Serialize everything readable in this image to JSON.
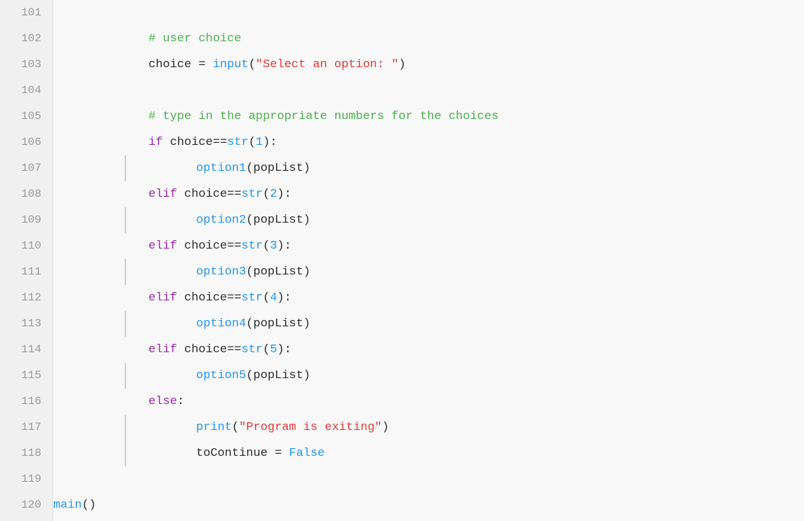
{
  "editor": {
    "background": "#f8f8f8",
    "lines": [
      {
        "num": "101",
        "indent": 0,
        "tokens": []
      },
      {
        "num": "102",
        "indent": 2,
        "tokens": [
          {
            "type": "comment",
            "text": "# user choice"
          }
        ]
      },
      {
        "num": "103",
        "indent": 2,
        "tokens": [
          {
            "type": "default",
            "text": "choice = "
          },
          {
            "type": "builtin",
            "text": "input"
          },
          {
            "type": "default",
            "text": "("
          },
          {
            "type": "string",
            "text": "\"Select an option: \""
          },
          {
            "type": "default",
            "text": ")"
          }
        ]
      },
      {
        "num": "104",
        "indent": 0,
        "tokens": []
      },
      {
        "num": "105",
        "indent": 2,
        "tokens": [
          {
            "type": "comment",
            "text": "# type in the appropriate numbers for the choices"
          }
        ]
      },
      {
        "num": "106",
        "indent": 2,
        "tokens": [
          {
            "type": "keyword",
            "text": "if "
          },
          {
            "type": "default",
            "text": "choice=="
          },
          {
            "type": "builtin",
            "text": "str"
          },
          {
            "type": "default",
            "text": "("
          },
          {
            "type": "number",
            "text": "1"
          },
          {
            "type": "default",
            "text": "):"
          }
        ]
      },
      {
        "num": "107",
        "indent": 3,
        "guide": true,
        "tokens": [
          {
            "type": "func",
            "text": "option1"
          },
          {
            "type": "default",
            "text": "(popList)"
          }
        ]
      },
      {
        "num": "108",
        "indent": 2,
        "tokens": [
          {
            "type": "keyword",
            "text": "elif "
          },
          {
            "type": "default",
            "text": "choice=="
          },
          {
            "type": "builtin",
            "text": "str"
          },
          {
            "type": "default",
            "text": "("
          },
          {
            "type": "number",
            "text": "2"
          },
          {
            "type": "default",
            "text": "):"
          }
        ]
      },
      {
        "num": "109",
        "indent": 3,
        "guide": true,
        "tokens": [
          {
            "type": "func",
            "text": "option2"
          },
          {
            "type": "default",
            "text": "(popList)"
          }
        ]
      },
      {
        "num": "110",
        "indent": 2,
        "tokens": [
          {
            "type": "keyword",
            "text": "elif "
          },
          {
            "type": "default",
            "text": "choice=="
          },
          {
            "type": "builtin",
            "text": "str"
          },
          {
            "type": "default",
            "text": "("
          },
          {
            "type": "number",
            "text": "3"
          },
          {
            "type": "default",
            "text": "):"
          }
        ]
      },
      {
        "num": "111",
        "indent": 3,
        "guide": true,
        "tokens": [
          {
            "type": "func",
            "text": "option3"
          },
          {
            "type": "default",
            "text": "(popList)"
          }
        ]
      },
      {
        "num": "112",
        "indent": 2,
        "tokens": [
          {
            "type": "keyword",
            "text": "elif "
          },
          {
            "type": "default",
            "text": "choice=="
          },
          {
            "type": "builtin",
            "text": "str"
          },
          {
            "type": "default",
            "text": "("
          },
          {
            "type": "number",
            "text": "4"
          },
          {
            "type": "default",
            "text": "):"
          }
        ]
      },
      {
        "num": "113",
        "indent": 3,
        "guide": true,
        "tokens": [
          {
            "type": "func",
            "text": "option4"
          },
          {
            "type": "default",
            "text": "(popList)"
          }
        ]
      },
      {
        "num": "114",
        "indent": 2,
        "tokens": [
          {
            "type": "keyword",
            "text": "elif "
          },
          {
            "type": "default",
            "text": "choice=="
          },
          {
            "type": "builtin",
            "text": "str"
          },
          {
            "type": "default",
            "text": "("
          },
          {
            "type": "number",
            "text": "5"
          },
          {
            "type": "default",
            "text": "):"
          }
        ]
      },
      {
        "num": "115",
        "indent": 3,
        "guide": true,
        "tokens": [
          {
            "type": "func",
            "text": "option5"
          },
          {
            "type": "default",
            "text": "(popList)"
          }
        ]
      },
      {
        "num": "116",
        "indent": 2,
        "tokens": [
          {
            "type": "keyword",
            "text": "else"
          },
          {
            "type": "default",
            "text": ":"
          }
        ]
      },
      {
        "num": "117",
        "indent": 3,
        "guide": true,
        "tokens": [
          {
            "type": "builtin",
            "text": "print"
          },
          {
            "type": "default",
            "text": "("
          },
          {
            "type": "string",
            "text": "\"Program is exiting\""
          },
          {
            "type": "default",
            "text": ")"
          }
        ]
      },
      {
        "num": "118",
        "indent": 3,
        "guide": true,
        "tokens": [
          {
            "type": "default",
            "text": "toContinue = "
          },
          {
            "type": "false",
            "text": "False"
          }
        ]
      },
      {
        "num": "119",
        "indent": 0,
        "tokens": []
      },
      {
        "num": "120",
        "indent": 0,
        "tokens": [
          {
            "type": "func",
            "text": "main"
          },
          {
            "type": "default",
            "text": "()"
          }
        ]
      }
    ]
  }
}
